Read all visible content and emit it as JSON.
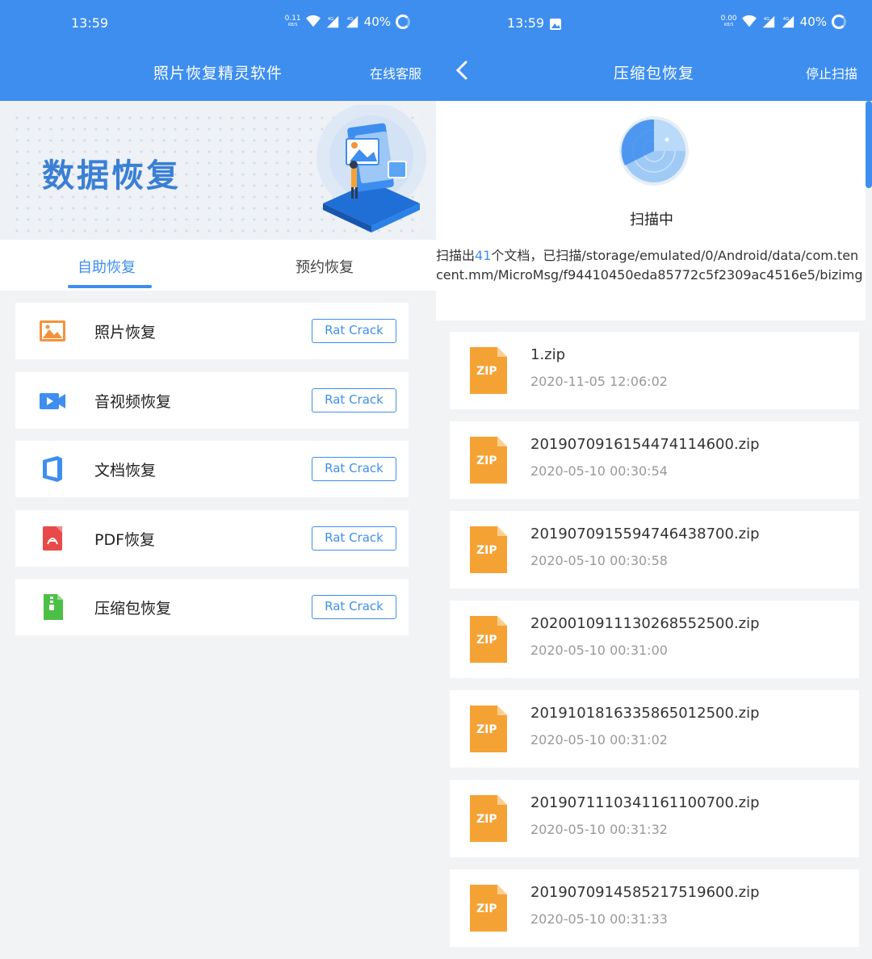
{
  "left": {
    "status": {
      "time": "13:59",
      "speed": "0.11",
      "speed_unit": "KB/S",
      "signal1": "4G",
      "signal2": "4G",
      "battery": "40%"
    },
    "header": {
      "title": "照片恢复精灵软件",
      "action": "在线客服"
    },
    "banner": {
      "title": "数据恢复"
    },
    "tabs": [
      {
        "label": "自助恢复"
      },
      {
        "label": "预约恢复"
      }
    ],
    "items": [
      {
        "label": "照片恢复",
        "button": "Rat Crack",
        "icon": "photo-icon",
        "color": "#f5923a"
      },
      {
        "label": "音视频恢复",
        "button": "Rat Crack",
        "icon": "video-icon",
        "color": "#3e8ef0"
      },
      {
        "label": "文档恢复",
        "button": "Rat Crack",
        "icon": "document-icon",
        "color": "#3e8ef0"
      },
      {
        "label": "PDF恢复",
        "button": "Rat Crack",
        "icon": "pdf-icon",
        "color": "#e84a4a"
      },
      {
        "label": "压缩包恢复",
        "button": "Rat Crack",
        "icon": "archive-icon",
        "color": "#4cc046"
      }
    ]
  },
  "right": {
    "status": {
      "time": "13:59",
      "speed": "0.00",
      "speed_unit": "KB/S",
      "signal1": "4G",
      "signal2": "4G",
      "battery": "40%"
    },
    "header": {
      "title": "压缩包恢复",
      "action": "停止扫描"
    },
    "scan": {
      "status": "扫描中",
      "prefix": "扫描出",
      "count": "41",
      "suffix": "个文档，已扫描/storage/emulated/0/Android/data/com.tencent.mm/MicroMsg/f94410450eda85772c5f2309ac4516e5/bizimg"
    },
    "files": [
      {
        "name": "1.zip",
        "date": "2020-11-05 12:06:02"
      },
      {
        "name": "20190709161544741146 00.zip",
        "date": "2020-05-10 00:30:54"
      },
      {
        "name": "2019070915594746438700.zip",
        "date": "2020-05-10 00:30:58"
      },
      {
        "name": "2020010911130268552500.zip",
        "date": "2020-05-10 00:31:00"
      },
      {
        "name": "2019101816335865012500.zip",
        "date": "2020-05-10 00:31:02"
      },
      {
        "name": "2019071110341161100700.zip",
        "date": "2020-05-10 00:31:32"
      },
      {
        "name": "2019070914585217519600.zip",
        "date": "2020-05-10 00:31:33"
      }
    ],
    "zip_label": "ZIP",
    "accent": "#3e8ef0",
    "zip_color": "#f5a235"
  }
}
